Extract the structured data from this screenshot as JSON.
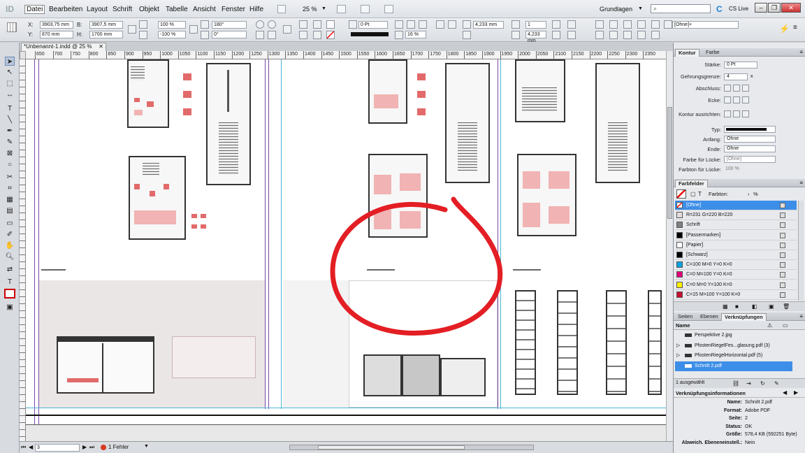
{
  "app": {
    "logo": "ID"
  },
  "menu": {
    "items": [
      "Datei",
      "Bearbeiten",
      "Layout",
      "Schrift",
      "Objekt",
      "Tabelle",
      "Ansicht",
      "Fenster",
      "Hilfe"
    ],
    "zoom": "25 %",
    "workspace": "Grundlagen",
    "cslive": "CS Live"
  },
  "control": {
    "x": "3903,75 mm",
    "y": "870 mm",
    "w": "3907,5 mm",
    "h": "1700 mm",
    "scale_x": "100 %",
    "scale_y": "-100 %",
    "rotate": "180°",
    "shear": "0°",
    "stroke_weight": "0 Pt",
    "opacity": "16 %",
    "gap": "4,233 mm",
    "gap2": "4,233 mm",
    "columns": "1",
    "style": "[Ohne]+"
  },
  "document": {
    "tab_title": "*Unbenannt-1.indd @ 25 %"
  },
  "ruler": {
    "ticks": [
      "650",
      "700",
      "750",
      "800",
      "850",
      "900",
      "950",
      "1000",
      "1050",
      "1100",
      "1150",
      "1200",
      "1250",
      "1300",
      "1350",
      "1400",
      "1450",
      "1500",
      "1550",
      "1600",
      "1650",
      "1700",
      "1750",
      "1800",
      "1850",
      "1900",
      "1950",
      "2000",
      "2050",
      "2100",
      "2150",
      "2200",
      "2250",
      "2300",
      "2350"
    ]
  },
  "status": {
    "page": "3",
    "errors": "1 Fehler"
  },
  "stroke_panel": {
    "tabs": [
      "Kontur",
      "Farbe"
    ],
    "labels": {
      "weight": "Stärke:",
      "miter": "Gehrungsgrenze:",
      "cap": "Abschluss:",
      "corner": "Ecke:",
      "align": "Kontur ausrichten:",
      "type": "Typ:",
      "start": "Anfang:",
      "end": "Ende:",
      "gap_color": "Farbe für Lücke:",
      "gap_tint": "Farbton für Lücke:"
    },
    "values": {
      "weight": "0 Pt",
      "miter": "4",
      "miter_unit": "x",
      "start": "Ohne",
      "end": "Ohne",
      "gap_color": "[Ohne]",
      "gap_tint": "100 %"
    }
  },
  "swatches_panel": {
    "title": "Farbfelder",
    "tint_label": "Farbton:",
    "tint_unit": "%",
    "items": [
      {
        "name": "[Ohne]",
        "color": "#ffffff",
        "selected": true
      },
      {
        "name": "R=231 G=220 B=220",
        "color": "#e7dcdc"
      },
      {
        "name": "Schrift",
        "color": "#808080"
      },
      {
        "name": "[Passermarken]",
        "color": "#000000"
      },
      {
        "name": "[Papier]",
        "color": "#ffffff"
      },
      {
        "name": "[Schwarz]",
        "color": "#000000"
      },
      {
        "name": "C=100 M=0 Y=0 K=0",
        "color": "#00a0e0"
      },
      {
        "name": "C=0 M=100 Y=0 K=0",
        "color": "#e0007a"
      },
      {
        "name": "C=0 M=0 Y=100 K=0",
        "color": "#fff000"
      },
      {
        "name": "C=15 M=100 Y=100 K=0",
        "color": "#c8102e"
      }
    ]
  },
  "links_panel": {
    "tabs": [
      "Seiten",
      "Ebenen",
      "Verknüpfungen"
    ],
    "column_header": "Name",
    "items": [
      {
        "name": "Perspektive 2.jpg"
      },
      {
        "name": "PfostenRiegelFes...glasung.pdf (3)"
      },
      {
        "name": "PfostenRiegelHorizontal.pdf (5)"
      },
      {
        "name": "Schnitt 2.pdf",
        "selected": true
      }
    ],
    "selection_count": "1 ausgewählt"
  },
  "link_info": {
    "title": "Verknüpfungsinformationen",
    "rows": [
      {
        "key": "Name:",
        "value": "Schnitt 2.pdf"
      },
      {
        "key": "Format:",
        "value": "Adobe PDF"
      },
      {
        "key": "Seite:",
        "value": "2"
      },
      {
        "key": "Status:",
        "value": "OK"
      },
      {
        "key": "Größe:",
        "value": "578,4 KB (592251 Byte)"
      },
      {
        "key": "Abweich. Ebeneneinstell.:",
        "value": "Nein"
      }
    ]
  },
  "colors": {
    "annotation": "#e31e24",
    "selection": "#3d8ee8",
    "guide": "#6f3d9c"
  }
}
